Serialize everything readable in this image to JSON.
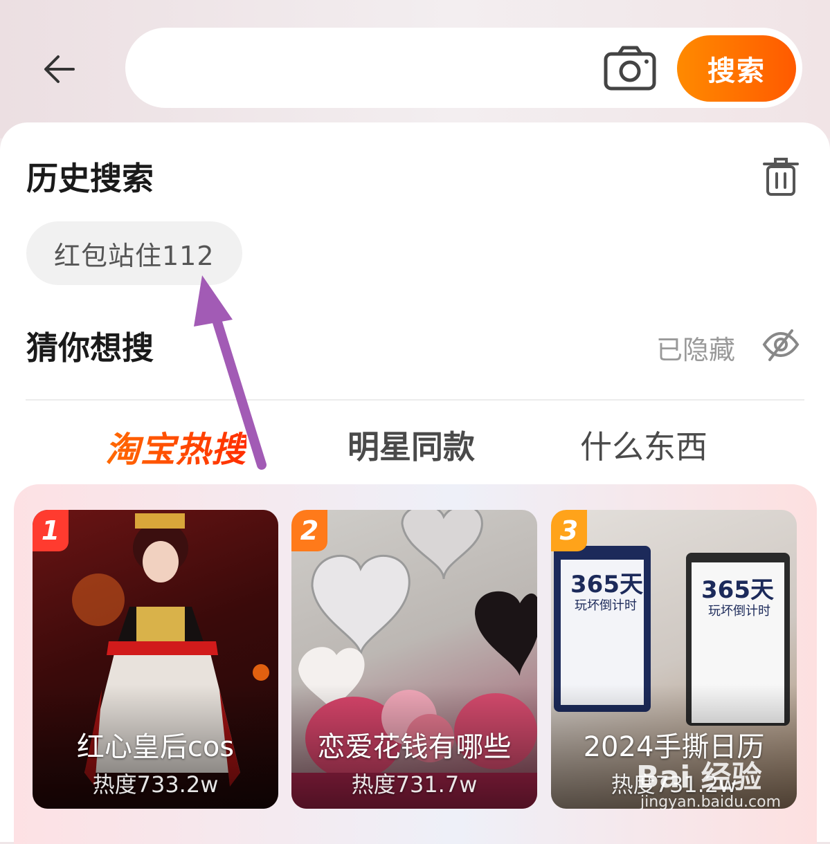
{
  "header": {
    "search_placeholder": "",
    "search_button_label": "搜索"
  },
  "history": {
    "title": "历史搜索",
    "items": [
      "红包站住112"
    ]
  },
  "guess": {
    "title": "猜你想搜",
    "hidden_label": "已隐藏"
  },
  "tabs": [
    {
      "label": "淘宝热搜",
      "active": true
    },
    {
      "label": "明星同款",
      "active": false
    },
    {
      "label": "什么东西",
      "active": false
    }
  ],
  "hot_cards": [
    {
      "rank": "1",
      "title": "红心皇后cos",
      "heat": "热度733.2w"
    },
    {
      "rank": "2",
      "title": "恋爱花钱有哪些",
      "heat": "热度731.7w"
    },
    {
      "rank": "3",
      "title": "2024手撕日历",
      "heat": "热度731.2w"
    }
  ],
  "card_decor": {
    "card3_book_text": "365天",
    "card3_book_sub": "玩坏倒计时"
  },
  "watermark": {
    "brand": "Bai 经验",
    "url": "jingyan.baidu.com"
  },
  "colors": {
    "accent": "#ff5000",
    "annotation_arrow": "#a25bb5"
  }
}
